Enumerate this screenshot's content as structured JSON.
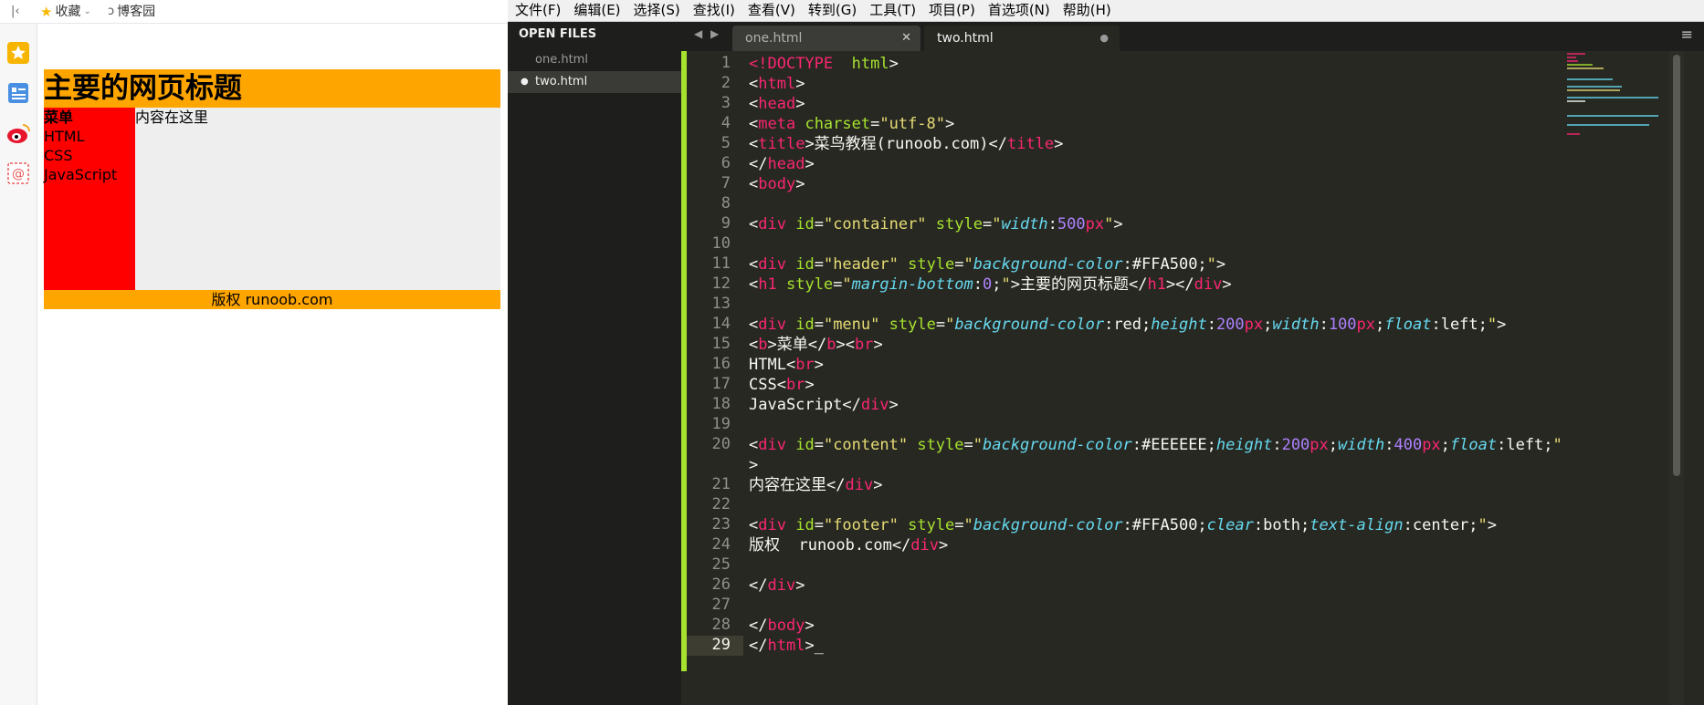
{
  "browser": {
    "bookmarks": [
      {
        "label": "收藏",
        "icon": "star-icon"
      },
      {
        "label": "博客园",
        "icon": "cnblogs-icon"
      }
    ],
    "side_icons": [
      "favorites-star-icon",
      "reader-list-icon",
      "weibo-icon",
      "email-icon"
    ],
    "page": {
      "heading": "主要的网页标题",
      "menu_title": "菜单",
      "menu_items": [
        "HTML",
        "CSS",
        "JavaScript"
      ],
      "content": "内容在这里",
      "footer": "版权 runoob.com"
    }
  },
  "editor": {
    "menu": [
      "文件(F)",
      "编辑(E)",
      "选择(S)",
      "查找(I)",
      "查看(V)",
      "转到(G)",
      "工具(T)",
      "项目(P)",
      "首选项(N)",
      "帮助(H)"
    ],
    "sidebar_title": "OPEN FILES",
    "open_files": [
      "one.html",
      "two.html"
    ],
    "active_file": "two.html",
    "tabs": [
      {
        "label": "one.html"
      },
      {
        "label": "two.html"
      }
    ],
    "line_numbers": [
      "1",
      "2",
      "3",
      "4",
      "5",
      "6",
      "7",
      "8",
      "9",
      "10",
      "11",
      "12",
      "13",
      "14",
      "15",
      "16",
      "17",
      "18",
      "19",
      "20",
      "",
      "21",
      "22",
      "23",
      "24",
      "25",
      "26",
      "27",
      "28",
      "29"
    ],
    "colors": {
      "background": "#272822",
      "tag": "#f92672",
      "attr": "#a6e22e",
      "string": "#e6db74",
      "property": "#66d9ef",
      "number": "#ae81ff"
    }
  },
  "code_lines": [
    [
      [
        "kw",
        "<!"
      ],
      [
        "tag",
        "DOCTYPE"
      ],
      [
        "",
        "  "
      ],
      [
        "attr",
        "html"
      ],
      [
        "",
        ">"
      ]
    ],
    [
      [
        "",
        "<"
      ],
      [
        "tag",
        "html"
      ],
      [
        "",
        ">"
      ]
    ],
    [
      [
        "",
        "<"
      ],
      [
        "tag",
        "head"
      ],
      [
        "",
        ">"
      ]
    ],
    [
      [
        "",
        "<"
      ],
      [
        "tag",
        "meta"
      ],
      [
        "",
        " "
      ],
      [
        "attr",
        "charset"
      ],
      [
        "",
        "="
      ],
      [
        "str",
        "\"utf-8\""
      ],
      [
        "",
        ">"
      ]
    ],
    [
      [
        "",
        "<"
      ],
      [
        "tag",
        "title"
      ],
      [
        "",
        ">菜鸟教程(runoob.com)</"
      ],
      [
        "tag",
        "title"
      ],
      [
        "",
        ">"
      ]
    ],
    [
      [
        "",
        "</"
      ],
      [
        "tag",
        "head"
      ],
      [
        "",
        ">"
      ]
    ],
    [
      [
        "",
        "<"
      ],
      [
        "tag",
        "body"
      ],
      [
        "",
        ">"
      ]
    ],
    [],
    [
      [
        "",
        "<"
      ],
      [
        "tag",
        "div"
      ],
      [
        "",
        " "
      ],
      [
        "attr",
        "id"
      ],
      [
        "",
        "="
      ],
      [
        "str",
        "\"container\""
      ],
      [
        "",
        " "
      ],
      [
        "attr",
        "style"
      ],
      [
        "",
        "="
      ],
      [
        "str",
        "\""
      ],
      [
        "prop",
        "width"
      ],
      [
        "",
        ":"
      ],
      [
        "num",
        "500"
      ],
      [
        "tag",
        "px"
      ],
      [
        "str",
        "\""
      ],
      [
        "",
        ">"
      ]
    ],
    [],
    [
      [
        "",
        "<"
      ],
      [
        "tag",
        "div"
      ],
      [
        "",
        " "
      ],
      [
        "attr",
        "id"
      ],
      [
        "",
        "="
      ],
      [
        "str",
        "\"header\""
      ],
      [
        "",
        " "
      ],
      [
        "attr",
        "style"
      ],
      [
        "",
        "="
      ],
      [
        "str",
        "\""
      ],
      [
        "prop",
        "background-color"
      ],
      [
        "",
        ":#FFA500;"
      ],
      [
        "str",
        "\""
      ],
      [
        "",
        ">"
      ]
    ],
    [
      [
        "",
        "<"
      ],
      [
        "tag",
        "h1"
      ],
      [
        "",
        " "
      ],
      [
        "attr",
        "style"
      ],
      [
        "",
        "="
      ],
      [
        "str",
        "\""
      ],
      [
        "prop",
        "margin-bottom"
      ],
      [
        "",
        ":"
      ],
      [
        "num",
        "0"
      ],
      [
        "",
        ";"
      ],
      [
        "str",
        "\""
      ],
      [
        "",
        ">主要的网页标题</"
      ],
      [
        "tag",
        "h1"
      ],
      [
        "",
        "></"
      ],
      [
        "tag",
        "div"
      ],
      [
        "",
        ">"
      ]
    ],
    [],
    [
      [
        "",
        "<"
      ],
      [
        "tag",
        "div"
      ],
      [
        "",
        " "
      ],
      [
        "attr",
        "id"
      ],
      [
        "",
        "="
      ],
      [
        "str",
        "\"menu\""
      ],
      [
        "",
        " "
      ],
      [
        "attr",
        "style"
      ],
      [
        "",
        "="
      ],
      [
        "str",
        "\""
      ],
      [
        "prop",
        "background-color"
      ],
      [
        "",
        ":red;"
      ],
      [
        "prop",
        "height"
      ],
      [
        "",
        ":"
      ],
      [
        "num",
        "200"
      ],
      [
        "tag",
        "px"
      ],
      [
        "",
        ";"
      ],
      [
        "prop",
        "width"
      ],
      [
        "",
        ":"
      ],
      [
        "num",
        "100"
      ],
      [
        "tag",
        "px"
      ],
      [
        "",
        ";"
      ],
      [
        "prop",
        "float"
      ],
      [
        "",
        ":left;"
      ],
      [
        "str",
        "\""
      ],
      [
        "",
        ">"
      ]
    ],
    [
      [
        "",
        "<"
      ],
      [
        "tag",
        "b"
      ],
      [
        "",
        ">菜单</"
      ],
      [
        "tag",
        "b"
      ],
      [
        "",
        "><"
      ],
      [
        "tag",
        "br"
      ],
      [
        "",
        ">"
      ]
    ],
    [
      [
        "",
        "HTML<"
      ],
      [
        "tag",
        "br"
      ],
      [
        "",
        ">"
      ]
    ],
    [
      [
        "",
        "CSS<"
      ],
      [
        "tag",
        "br"
      ],
      [
        "",
        ">"
      ]
    ],
    [
      [
        "",
        "JavaScript</"
      ],
      [
        "tag",
        "div"
      ],
      [
        "",
        ">"
      ]
    ],
    [],
    [
      [
        "",
        "<"
      ],
      [
        "tag",
        "div"
      ],
      [
        "",
        " "
      ],
      [
        "attr",
        "id"
      ],
      [
        "",
        "="
      ],
      [
        "str",
        "\"content\""
      ],
      [
        "",
        " "
      ],
      [
        "attr",
        "style"
      ],
      [
        "",
        "="
      ],
      [
        "str",
        "\""
      ],
      [
        "prop",
        "background-color"
      ],
      [
        "",
        ":#EEEEEE;"
      ],
      [
        "prop",
        "height"
      ],
      [
        "",
        ":"
      ],
      [
        "num",
        "200"
      ],
      [
        "tag",
        "px"
      ],
      [
        "",
        ";"
      ],
      [
        "prop",
        "width"
      ],
      [
        "",
        ":"
      ],
      [
        "num",
        "400"
      ],
      [
        "tag",
        "px"
      ],
      [
        "",
        ";"
      ],
      [
        "prop",
        "float"
      ],
      [
        "",
        ":left;"
      ],
      [
        "str",
        "\""
      ]
    ],
    [
      [
        "",
        ">"
      ]
    ],
    [
      [
        "",
        "内容在这里</"
      ],
      [
        "tag",
        "div"
      ],
      [
        "",
        ">"
      ]
    ],
    [],
    [
      [
        "",
        "<"
      ],
      [
        "tag",
        "div"
      ],
      [
        "",
        " "
      ],
      [
        "attr",
        "id"
      ],
      [
        "",
        "="
      ],
      [
        "str",
        "\"footer\""
      ],
      [
        "",
        " "
      ],
      [
        "attr",
        "style"
      ],
      [
        "",
        "="
      ],
      [
        "str",
        "\""
      ],
      [
        "prop",
        "background-color"
      ],
      [
        "",
        ":#FFA500;"
      ],
      [
        "prop",
        "clear"
      ],
      [
        "",
        ":both;"
      ],
      [
        "prop",
        "text-align"
      ],
      [
        "",
        ":center;"
      ],
      [
        "str",
        "\""
      ],
      [
        "",
        ">"
      ]
    ],
    [
      [
        "",
        "版权  runoob.com</"
      ],
      [
        "tag",
        "div"
      ],
      [
        "",
        ">"
      ]
    ],
    [],
    [
      [
        "",
        "</"
      ],
      [
        "tag",
        "div"
      ],
      [
        "",
        ">"
      ]
    ],
    [],
    [
      [
        "",
        "</"
      ],
      [
        "tag",
        "body"
      ],
      [
        "",
        ">"
      ]
    ],
    [
      [
        "",
        "</"
      ],
      [
        "tag",
        "html"
      ],
      [
        "",
        ">_"
      ]
    ]
  ]
}
